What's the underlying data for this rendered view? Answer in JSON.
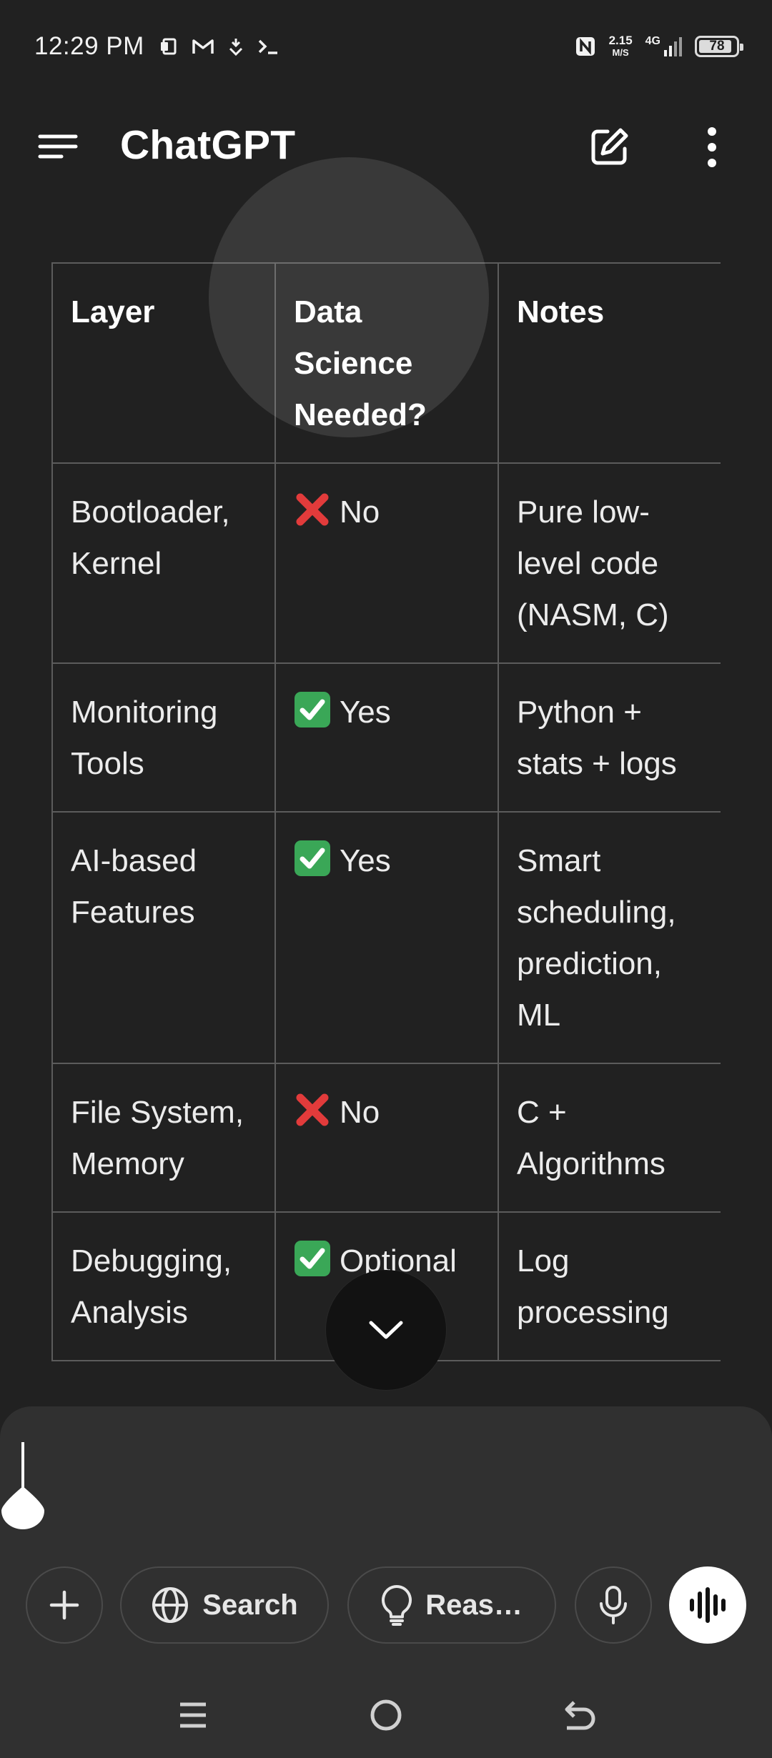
{
  "status_bar": {
    "time": "12:29 PM",
    "left_icons": [
      "photo-icon",
      "gmail-icon",
      "download-icon",
      "terminal-icon"
    ],
    "nfc_icon": "nfc-icon",
    "net_speed_value": "2.15",
    "net_speed_unit": "M/S",
    "network_type": "4G",
    "signal_icon": "signal-icon",
    "battery_level": "78"
  },
  "header": {
    "title": "ChatGPT",
    "menu_icon": "menu-icon",
    "new_chat_icon": "new-chat-icon",
    "more_icon": "more-vertical-icon"
  },
  "table": {
    "headers": [
      "Layer",
      "Data Science Needed?",
      "Notes"
    ],
    "rows": [
      {
        "layer": "Bootloader, Kernel",
        "needed_icon": "cross-icon",
        "needed": "No",
        "notes": "Pure low-level code (NASM, C)"
      },
      {
        "layer": "Monitoring Tools",
        "needed_icon": "check-icon",
        "needed": "Yes",
        "notes": "Python + stats + logs"
      },
      {
        "layer": "AI-based Features",
        "needed_icon": "check-icon",
        "needed": "Yes",
        "notes": "Smart scheduling, prediction, ML"
      },
      {
        "layer": "File System, Memory",
        "needed_icon": "cross-icon",
        "needed": "No",
        "notes": "C + Algorithms"
      },
      {
        "layer": "Debugging, Analysis",
        "needed_icon": "check-icon",
        "needed": "Optional",
        "notes": "Log processing"
      }
    ]
  },
  "scroll_down_icon": "chevron-down-icon",
  "composer": {
    "input_value": "",
    "add_icon": "plus-icon",
    "search_label": "Search",
    "search_icon": "globe-icon",
    "reason_label": "Reas…",
    "reason_icon": "lightbulb-icon",
    "mic_icon": "microphone-icon",
    "voice_icon": "voice-mode-icon"
  },
  "nav_bar": {
    "recents_icon": "recent-apps-icon",
    "home_icon": "home-icon",
    "back_icon": "back-icon"
  },
  "colors": {
    "background": "#212121",
    "composer": "#303030",
    "border": "#5c5c5c",
    "cross": "#e23b3b",
    "check": "#3aa757",
    "text": "#ececec"
  }
}
